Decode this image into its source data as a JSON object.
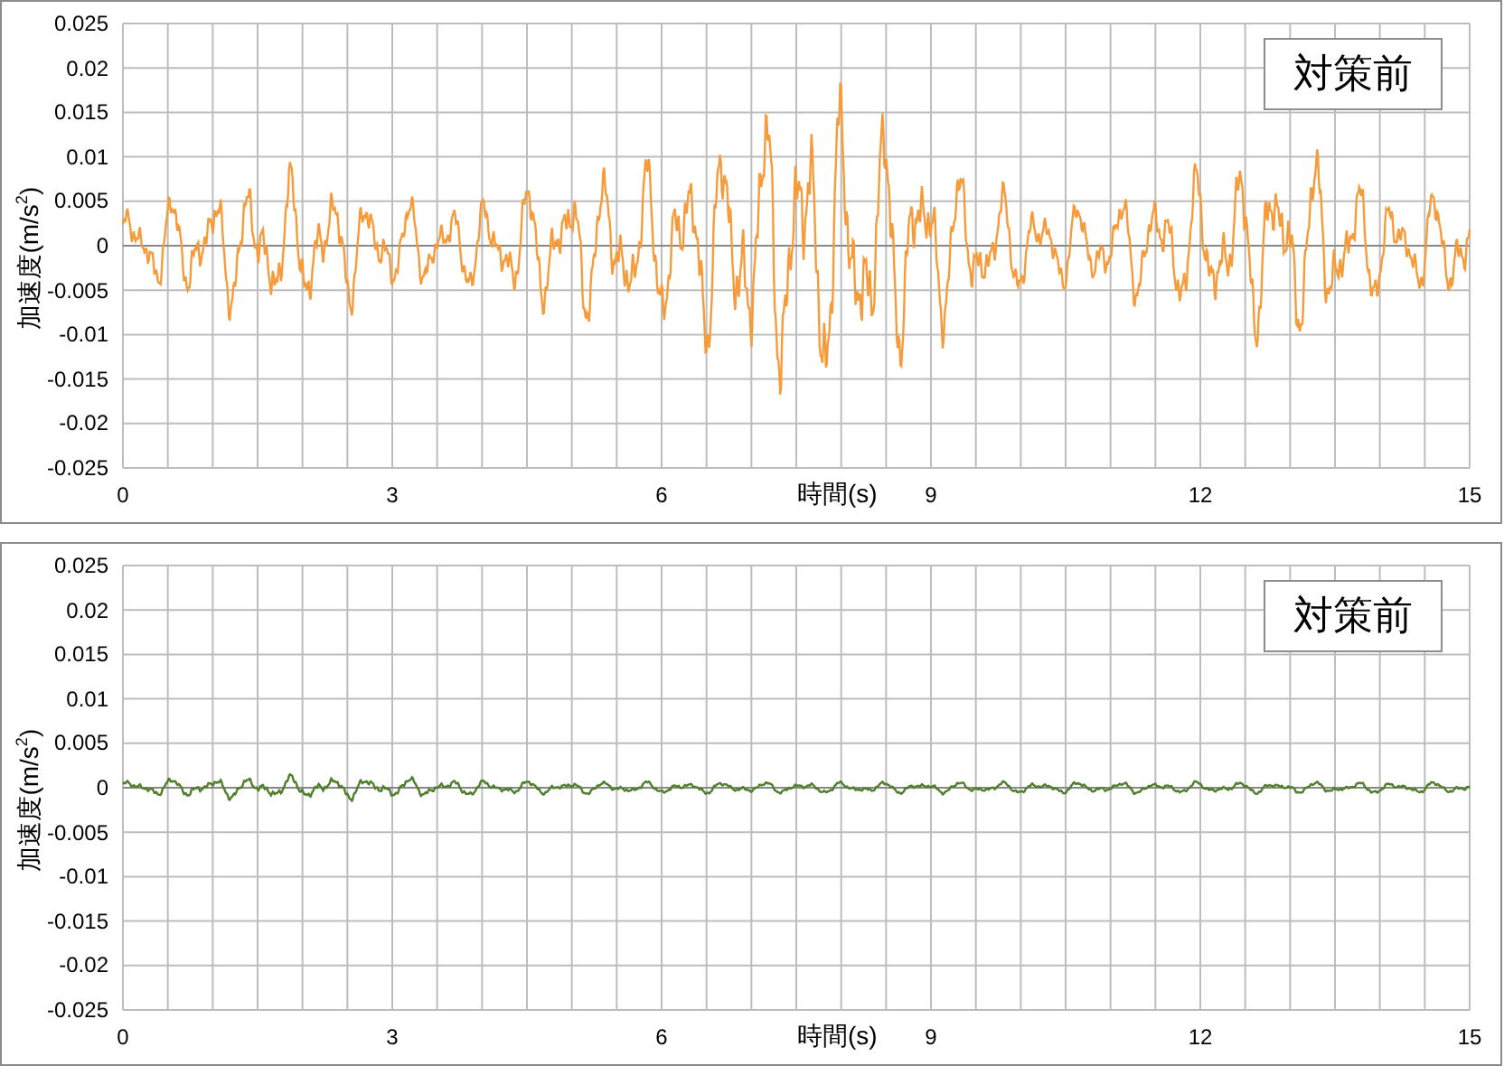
{
  "charts": [
    {
      "kind": "large-wave",
      "color": "#f79b3a",
      "legend": "対策前",
      "ylabel": "加速度(m/s$^{2}$)",
      "xlabel": "時間(s)",
      "yticks": [
        "0.025",
        "0.02",
        "0.015",
        "0.01",
        "0.005",
        "0",
        "-0.005",
        "-0.01",
        "-0.015",
        "-0.02",
        "-0.025"
      ],
      "xticks": [
        "0",
        "3",
        "6",
        "9",
        "12",
        "15"
      ]
    },
    {
      "kind": "small-wave",
      "color": "#4f7f2a",
      "legend": "対策前",
      "ylabel": "加速度(m/s$^{2}$)",
      "xlabel": "時間(s)",
      "yticks": [
        "0.025",
        "0.02",
        "0.015",
        "0.01",
        "0.005",
        "0",
        "-0.005",
        "-0.01",
        "-0.015",
        "-0.02",
        "-0.025"
      ],
      "xticks": [
        "0",
        "3",
        "6",
        "9",
        "12",
        "15"
      ]
    }
  ]
}
